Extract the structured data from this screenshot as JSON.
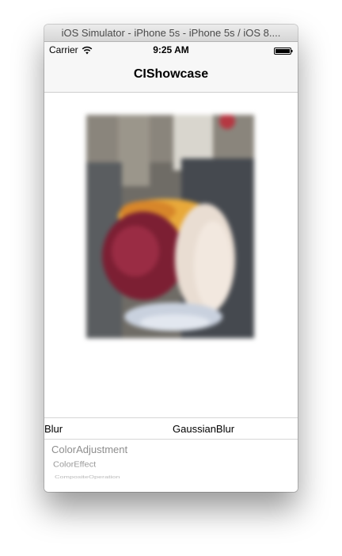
{
  "window": {
    "title": "iOS Simulator - iPhone 5s - iPhone 5s / iOS 8...."
  },
  "status_bar": {
    "carrier": "Carrier",
    "time": "9:25 AM",
    "wifi_icon": "wifi-icon",
    "battery_icon": "battery-icon"
  },
  "nav_bar": {
    "title": "CIShowcase"
  },
  "preview_image": {
    "description_icon": "blurred-photo",
    "effect": "GaussianBlur"
  },
  "filter_selection": {
    "category": "Blur",
    "filter": "GaussianBlur"
  },
  "picker": {
    "items": [
      "ColorAdjustment",
      "ColorEffect",
      "CompositeOperation"
    ]
  }
}
